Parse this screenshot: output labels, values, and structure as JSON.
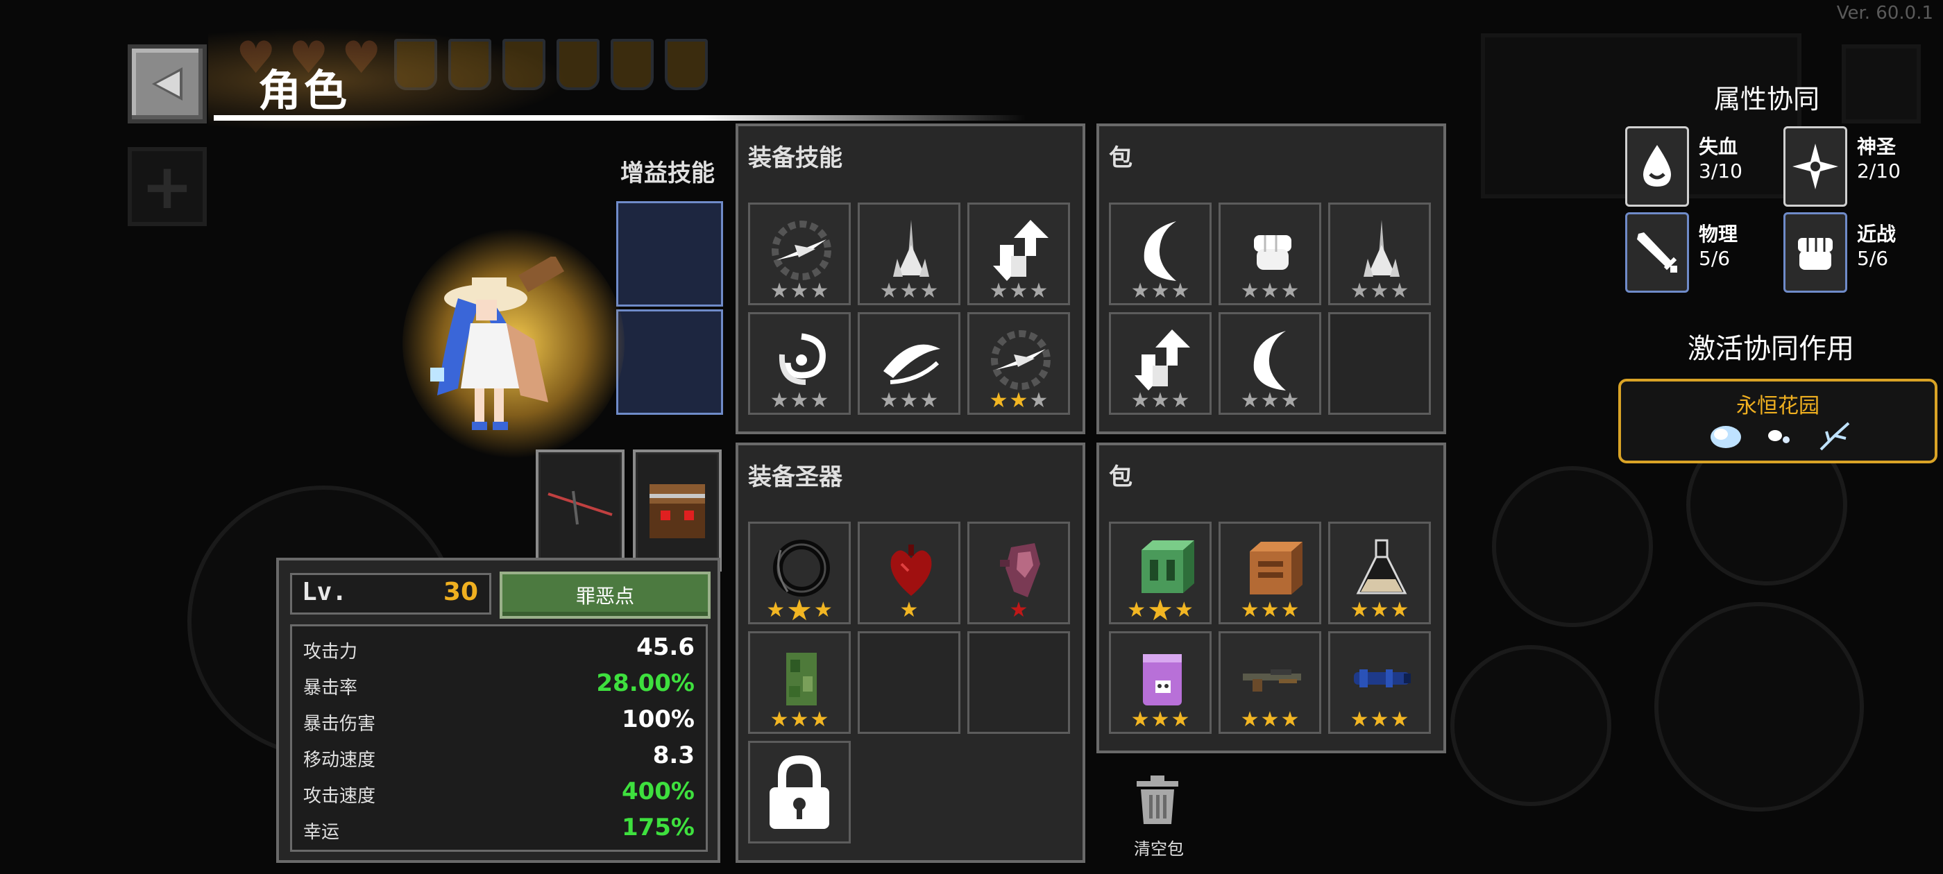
{
  "version": "Ver. 60.0.1",
  "header": {
    "title": "角色",
    "back_icon": "back-arrow-icon",
    "add_icon": "plus-icon"
  },
  "buff_skills": {
    "label": "增益技能"
  },
  "stats": {
    "level_label": "Lv.",
    "level_value": "30",
    "sin_button": "罪恶点",
    "rows": [
      {
        "label": "攻击力",
        "value": "45.6",
        "color": "#ffffff"
      },
      {
        "label": "暴击率",
        "value": "28.00%",
        "color": "#3ee03e"
      },
      {
        "label": "暴击伤害",
        "value": "100%",
        "color": "#ffffff"
      },
      {
        "label": "移动速度",
        "value": "8.3",
        "color": "#ffffff"
      },
      {
        "label": "攻击速度",
        "value": "400%",
        "color": "#3ee03e"
      },
      {
        "label": "幸运",
        "value": "175%",
        "color": "#3ee03e"
      }
    ]
  },
  "equip_skills": {
    "title": "装备技能",
    "slots": [
      {
        "icon": "sword-slash-icon",
        "stars": 3,
        "gold": 0
      },
      {
        "icon": "spear-burst-icon",
        "stars": 3,
        "gold": 0
      },
      {
        "icon": "arrow-up-icon",
        "stars": 3,
        "gold": 0
      },
      {
        "icon": "whirlwind-icon",
        "stars": 3,
        "gold": 0
      },
      {
        "icon": "crescent-slash-icon",
        "stars": 3,
        "gold": 0
      },
      {
        "icon": "sword-slash-icon",
        "stars": 3,
        "gold": 2
      }
    ]
  },
  "skill_bag": {
    "title": "包",
    "slots": [
      {
        "icon": "moon-slash-icon",
        "stars": 3,
        "gold": 0
      },
      {
        "icon": "fist-icon",
        "stars": 3,
        "gold": 0
      },
      {
        "icon": "spear-burst-icon",
        "stars": 3,
        "gold": 0
      },
      {
        "icon": "arrow-up-icon",
        "stars": 3,
        "gold": 0
      },
      {
        "icon": "moon-slash-icon",
        "stars": 3,
        "gold": 0
      },
      {
        "icon": "",
        "stars": 0,
        "gold": 0
      }
    ]
  },
  "equip_relics": {
    "title": "装备圣器",
    "slots": [
      {
        "icon": "dark-ring-icon",
        "stars": 3,
        "gold": 3,
        "mode": "big-center"
      },
      {
        "icon": "heart-relic-icon",
        "stars": 1,
        "gold": 1,
        "mode": "single"
      },
      {
        "icon": "crystal-relic-icon",
        "stars": 1,
        "gold": 0,
        "mode": "red"
      },
      {
        "icon": "camo-card-icon",
        "stars": 3,
        "gold": 3,
        "mode": "normal"
      },
      {
        "icon": "",
        "stars": 0,
        "gold": 0,
        "mode": "empty"
      },
      {
        "icon": "",
        "stars": 0,
        "gold": 0,
        "mode": "empty"
      }
    ],
    "locked_icon": "lock-icon"
  },
  "relic_bag": {
    "title": "包",
    "slots": [
      {
        "icon": "green-cube-icon",
        "stars": 3,
        "gold": 3,
        "mode": "big-center"
      },
      {
        "icon": "wood-cube-icon",
        "stars": 3,
        "gold": 3,
        "mode": "normal"
      },
      {
        "icon": "potion-flask-icon",
        "stars": 3,
        "gold": 3,
        "mode": "normal"
      },
      {
        "icon": "purple-jar-icon",
        "stars": 3,
        "gold": 3,
        "mode": "normal"
      },
      {
        "icon": "rifle-icon",
        "stars": 3,
        "gold": 3,
        "mode": "normal"
      },
      {
        "icon": "blue-cannon-icon",
        "stars": 3,
        "gold": 3,
        "mode": "normal"
      }
    ]
  },
  "trash": {
    "label": "清空包",
    "icon": "trash-icon"
  },
  "synergy": {
    "title": "属性协同",
    "items": [
      {
        "name": "失血",
        "count": "3/10",
        "icon": "blood-drop-icon"
      },
      {
        "name": "神圣",
        "count": "2/10",
        "icon": "holy-star-icon"
      },
      {
        "name": "物理",
        "count": "5/6",
        "icon": "sword-icon"
      },
      {
        "name": "近战",
        "count": "5/6",
        "icon": "fist-icon"
      }
    ],
    "active_title": "激活协同作用",
    "active": {
      "name": "永恒花园",
      "icons": [
        "cloud-flower-icon",
        "petals-icon",
        "branch-icon"
      ]
    }
  }
}
